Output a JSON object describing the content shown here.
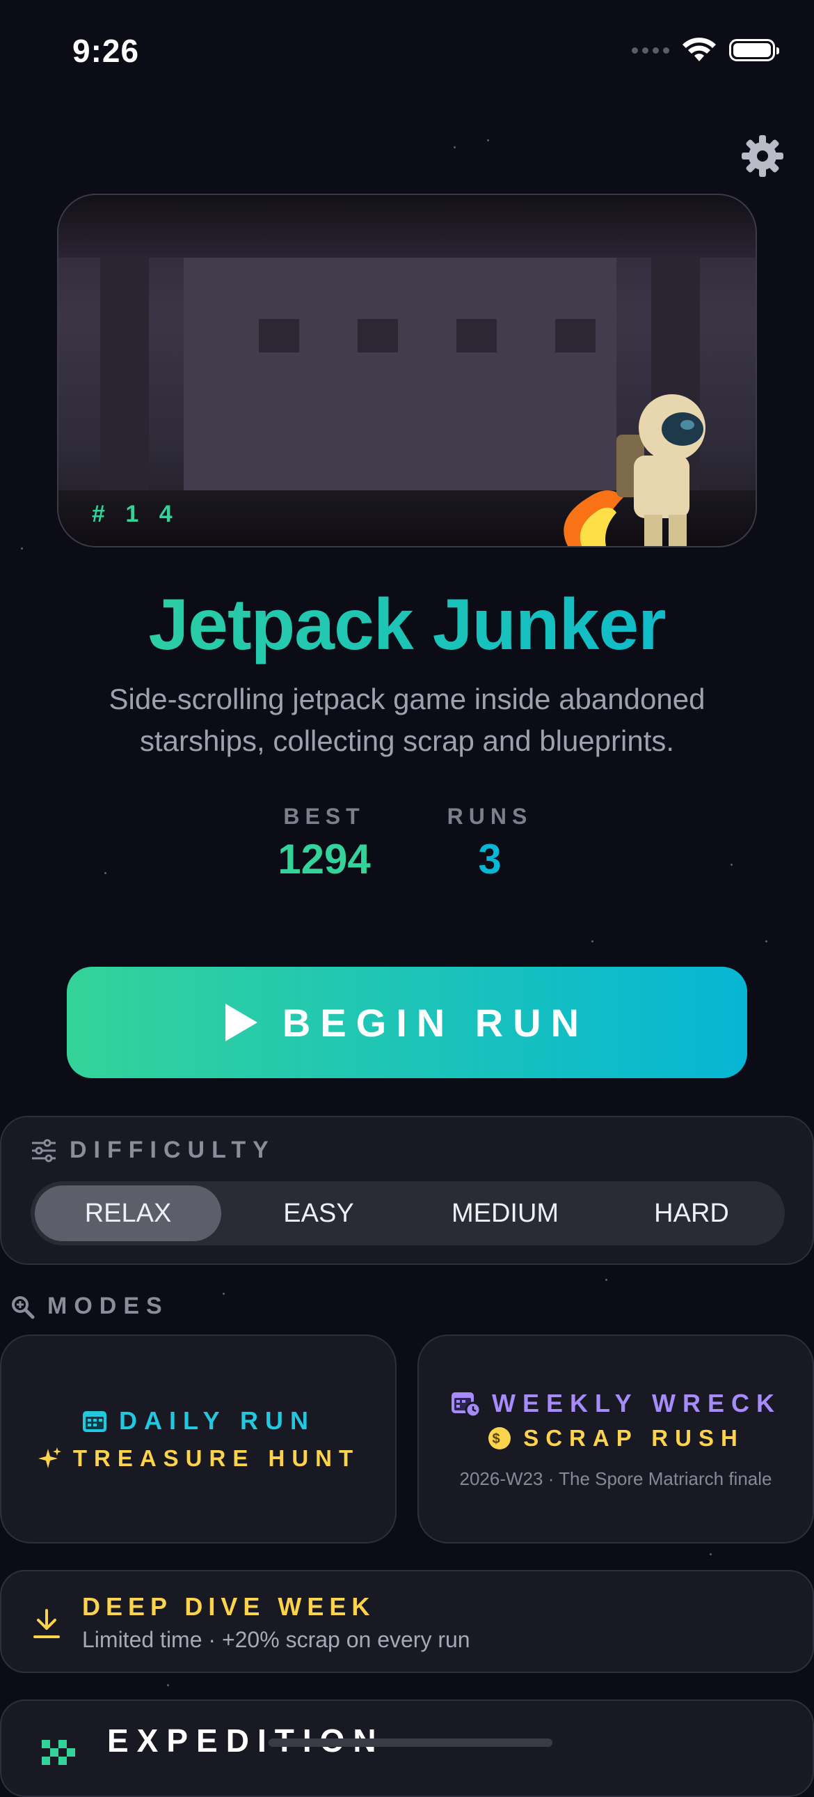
{
  "status_bar": {
    "time": "9:26"
  },
  "icons": {
    "settings": "gear-icon",
    "wifi": "wifi-icon",
    "battery": "battery-icon",
    "difficulty": "sliders-icon",
    "modes": "search-icon",
    "daily": "calendar-icon",
    "treasure": "sparkle-icon",
    "weekly": "calendar-clock-icon",
    "coin": "coin-icon",
    "deep_dive": "download-icon",
    "expedition": "checkered-flag-icon"
  },
  "hero": {
    "tag": "# 1 4"
  },
  "game": {
    "title": "Jetpack Junker",
    "subtitle": "Side-scrolling jetpack game inside abandoned starships, collecting scrap and blueprints."
  },
  "stats": {
    "best_label": "BEST",
    "best_value": "1294",
    "runs_label": "RUNS",
    "runs_value": "3"
  },
  "begin_label": "BEGIN RUN",
  "difficulty": {
    "heading": "DIFFICULTY",
    "options": [
      "RELAX",
      "EASY",
      "MEDIUM",
      "HARD"
    ],
    "selected": "RELAX"
  },
  "modes": {
    "heading": "MODES",
    "daily_label": "DAILY RUN",
    "treasure_label": "TREASURE HUNT",
    "weekly_label": "WEEKLY WRECK",
    "scrap_label": "SCRAP RUSH",
    "weekly_sub": "2026-W23 · The Spore Matriarch finale"
  },
  "deep_dive": {
    "title": "DEEP DIVE WEEK",
    "subtitle": "Limited time · +20% scrap on every run"
  },
  "expedition": {
    "title": "EXPEDITION"
  },
  "colors": {
    "accent_green": "#34d399",
    "accent_cyan": "#06b6d4",
    "purple": "#a78bfa",
    "gold": "#fcd34d",
    "background": "#0b0c16"
  }
}
